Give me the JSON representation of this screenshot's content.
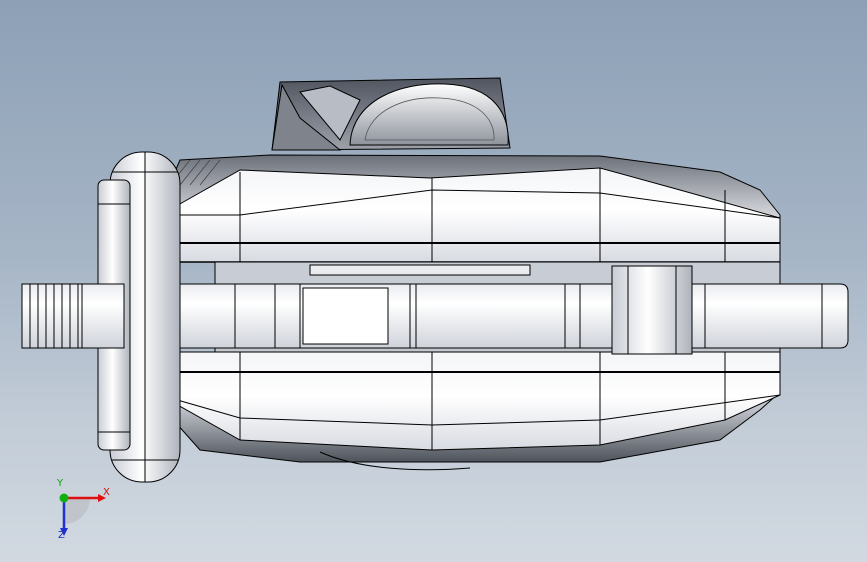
{
  "viewport": {
    "background_top": "#8da0b6",
    "background_bottom": "#d2d9e1",
    "model_fill": "#ffffff",
    "model_edge": "#000000"
  },
  "triad": {
    "x_label": "X",
    "y_label": "Y",
    "z_label": "Z",
    "x_color": "#e01010",
    "y_color": "#10b010",
    "z_color": "#2030d0"
  }
}
